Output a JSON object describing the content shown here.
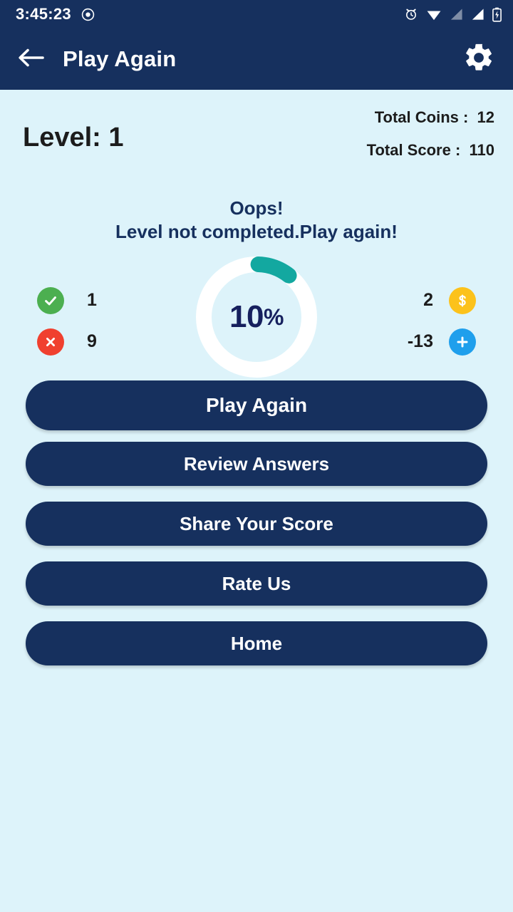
{
  "status_bar": {
    "time": "3:45:23",
    "left_icons": [
      "record-circle-icon"
    ],
    "right_icons": [
      "alarm-icon",
      "wifi-icon",
      "signal-1-icon",
      "signal-2-icon",
      "battery-charging-icon"
    ]
  },
  "app_bar": {
    "back_icon": "back-arrow-icon",
    "title": "Play Again",
    "settings_icon": "gear-icon"
  },
  "header": {
    "level": "Level: 1",
    "total_coins": "Total Coins :  12",
    "total_score": "Total Score :  110"
  },
  "message": {
    "line1": "Oops!",
    "line2": "Level not completed.Play again!"
  },
  "gauge": {
    "percent_number": "10",
    "percent_symbol": "%",
    "percent_value": 10,
    "track_color": "#ffffff",
    "progress_color": "#13a8a0",
    "text_color": "#16205e"
  },
  "stats": {
    "left": [
      {
        "icon": "check-circle-icon",
        "value": "1",
        "color": "#4caf50"
      },
      {
        "icon": "cross-circle-icon",
        "value": "9",
        "color": "#f0402f"
      }
    ],
    "right": [
      {
        "icon": "coin-dollar-icon",
        "value": "2",
        "color": "#fcc21b"
      },
      {
        "icon": "plus-circle-icon",
        "value": "-13",
        "color": "#1f9fec"
      }
    ]
  },
  "buttons": [
    {
      "label": "Play Again"
    },
    {
      "label": "Review Answers"
    },
    {
      "label": "Share Your Score"
    },
    {
      "label": "Rate Us"
    },
    {
      "label": "Home"
    }
  ],
  "theme": {
    "navy": "#16305e",
    "background": "#ddf3fa",
    "teal": "#13a8a0"
  }
}
